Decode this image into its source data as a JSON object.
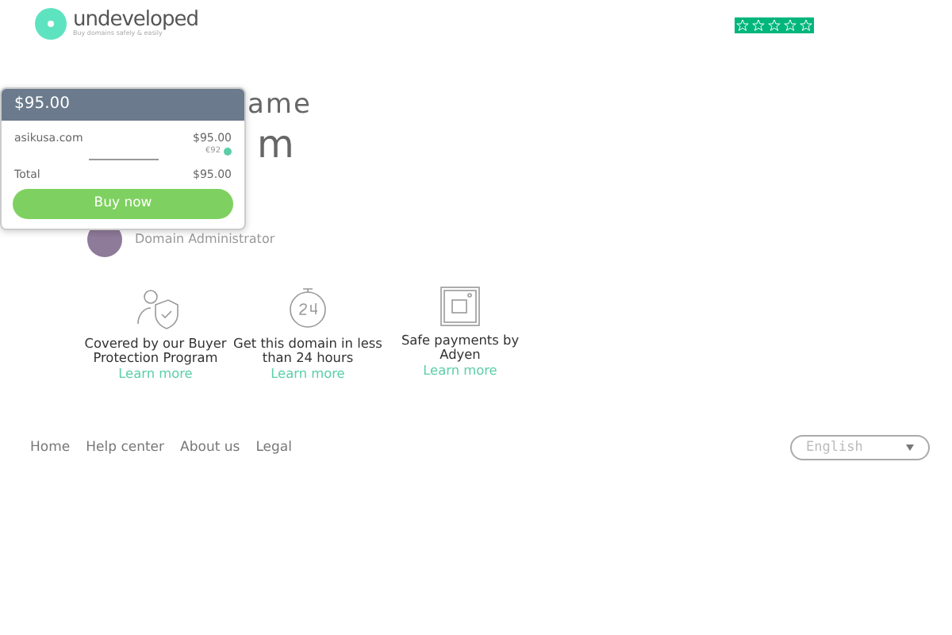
{
  "header": {
    "logo_name": "undeveloped",
    "logo_tagline": "Buy domains safely & easily",
    "rating": {
      "stars": 5
    }
  },
  "background_heading": {
    "line_1": "ame",
    "line_2": "m"
  },
  "owner": {
    "role": "Domain Administrator"
  },
  "features": [
    {
      "kind": "protection",
      "title": "Covered by our Buyer Protection Program",
      "link": "Learn more"
    },
    {
      "kind": "clock",
      "title": "Get this domain in less than 24 hours",
      "link": "Learn more"
    },
    {
      "kind": "payment",
      "title": "Safe payments by Adyen",
      "link": "Learn more"
    }
  ],
  "footer": {
    "links": [
      "Home",
      "Help center",
      "About us",
      "Legal"
    ],
    "language": "English"
  },
  "cart": {
    "price": "$95.00",
    "item": {
      "domain": "asikusa.com",
      "price": "$95.00",
      "alt_price": "€92"
    },
    "total_label": "Total",
    "total": "$95.00",
    "button": "Buy  now"
  }
}
